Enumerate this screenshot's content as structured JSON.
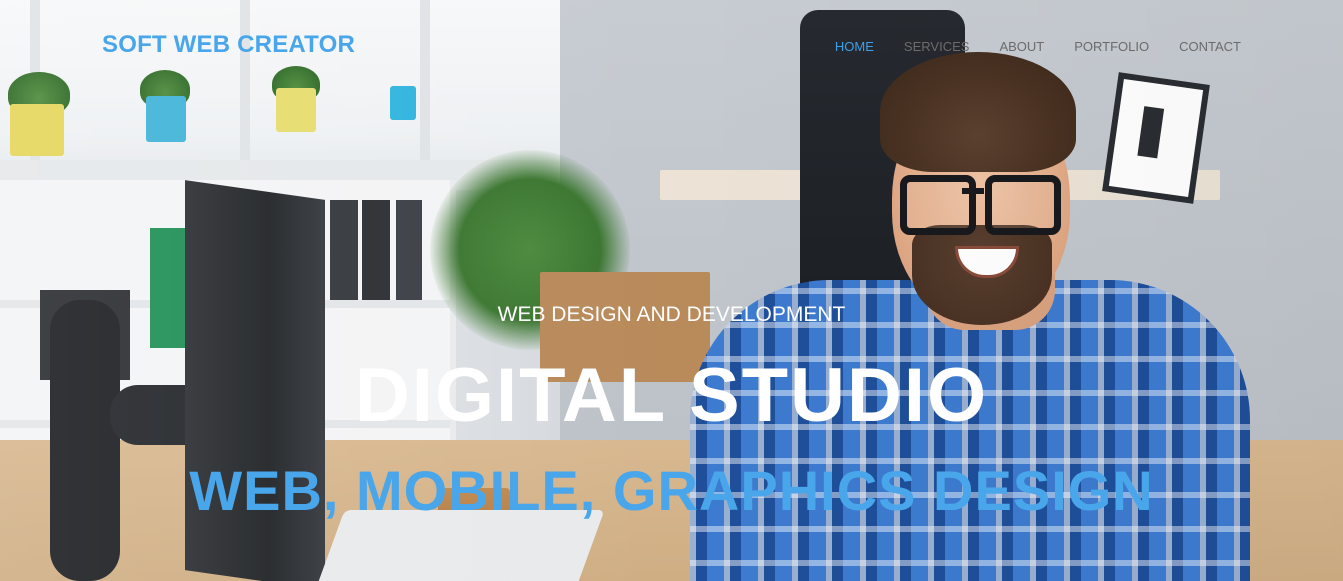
{
  "header": {
    "brand": "SOFT WEB CREATOR",
    "nav": [
      {
        "label": "HOME",
        "active": true
      },
      {
        "label": "SERVICES",
        "active": false
      },
      {
        "label": "ABOUT",
        "active": false
      },
      {
        "label": "PORTFOLIO",
        "active": false
      },
      {
        "label": "CONTACT",
        "active": false
      }
    ]
  },
  "hero": {
    "kicker": "WEB DESIGN AND DEVELOPMENT",
    "title": "DIGITAL STUDIO",
    "subtitle": "WEB, MOBILE, GRAPHICS DESIGN"
  },
  "colors": {
    "brand": "#4aa6ea",
    "nav_active": "#3f9fe8",
    "nav_default": "#6b6b6b",
    "hero_text": "#ffffff"
  }
}
